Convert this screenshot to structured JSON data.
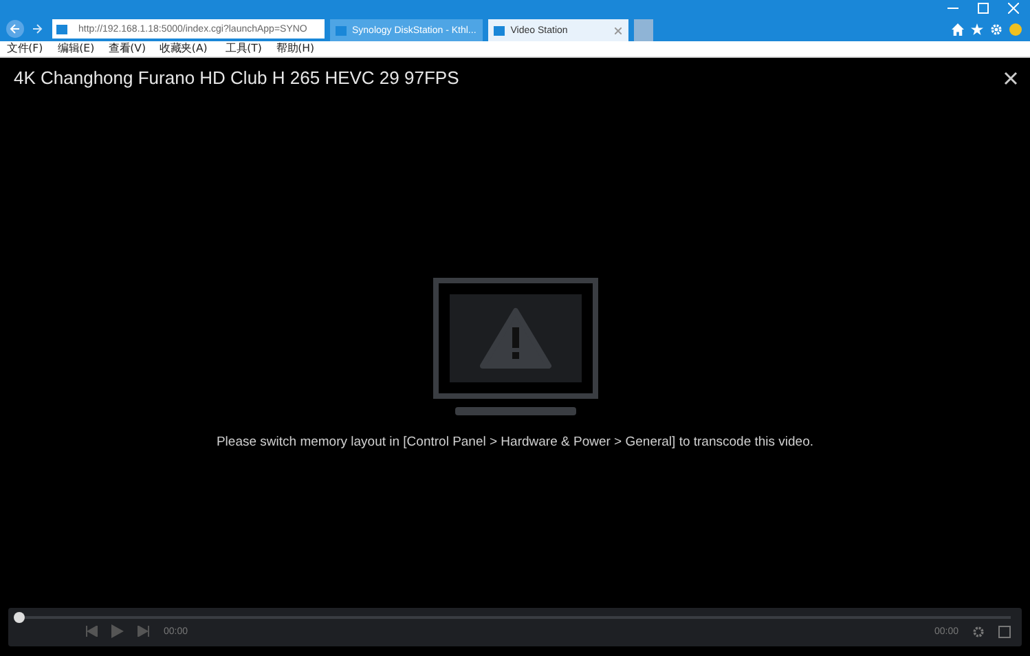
{
  "browser": {
    "address": "http://192.168.1.18:5000/index.cgi?launchApp=SYNO",
    "tabs": [
      {
        "label": "Synology DiskStation - Kthl...",
        "selected": false
      },
      {
        "label": "Video Station",
        "selected": true
      }
    ],
    "menu": [
      "文件(F)",
      "编辑(E)",
      "查看(V)",
      "收藏夹(A)",
      "工具(T)",
      "帮助(H)"
    ]
  },
  "player": {
    "title": "4K Changhong Furano HD Club H 265 HEVC 29 97FPS",
    "message": "Please switch memory layout in [Control Panel > Hardware & Power > General] to transcode this video.",
    "progress": {
      "level": 0.0,
      "current": "00:00",
      "total": "00:00"
    }
  }
}
